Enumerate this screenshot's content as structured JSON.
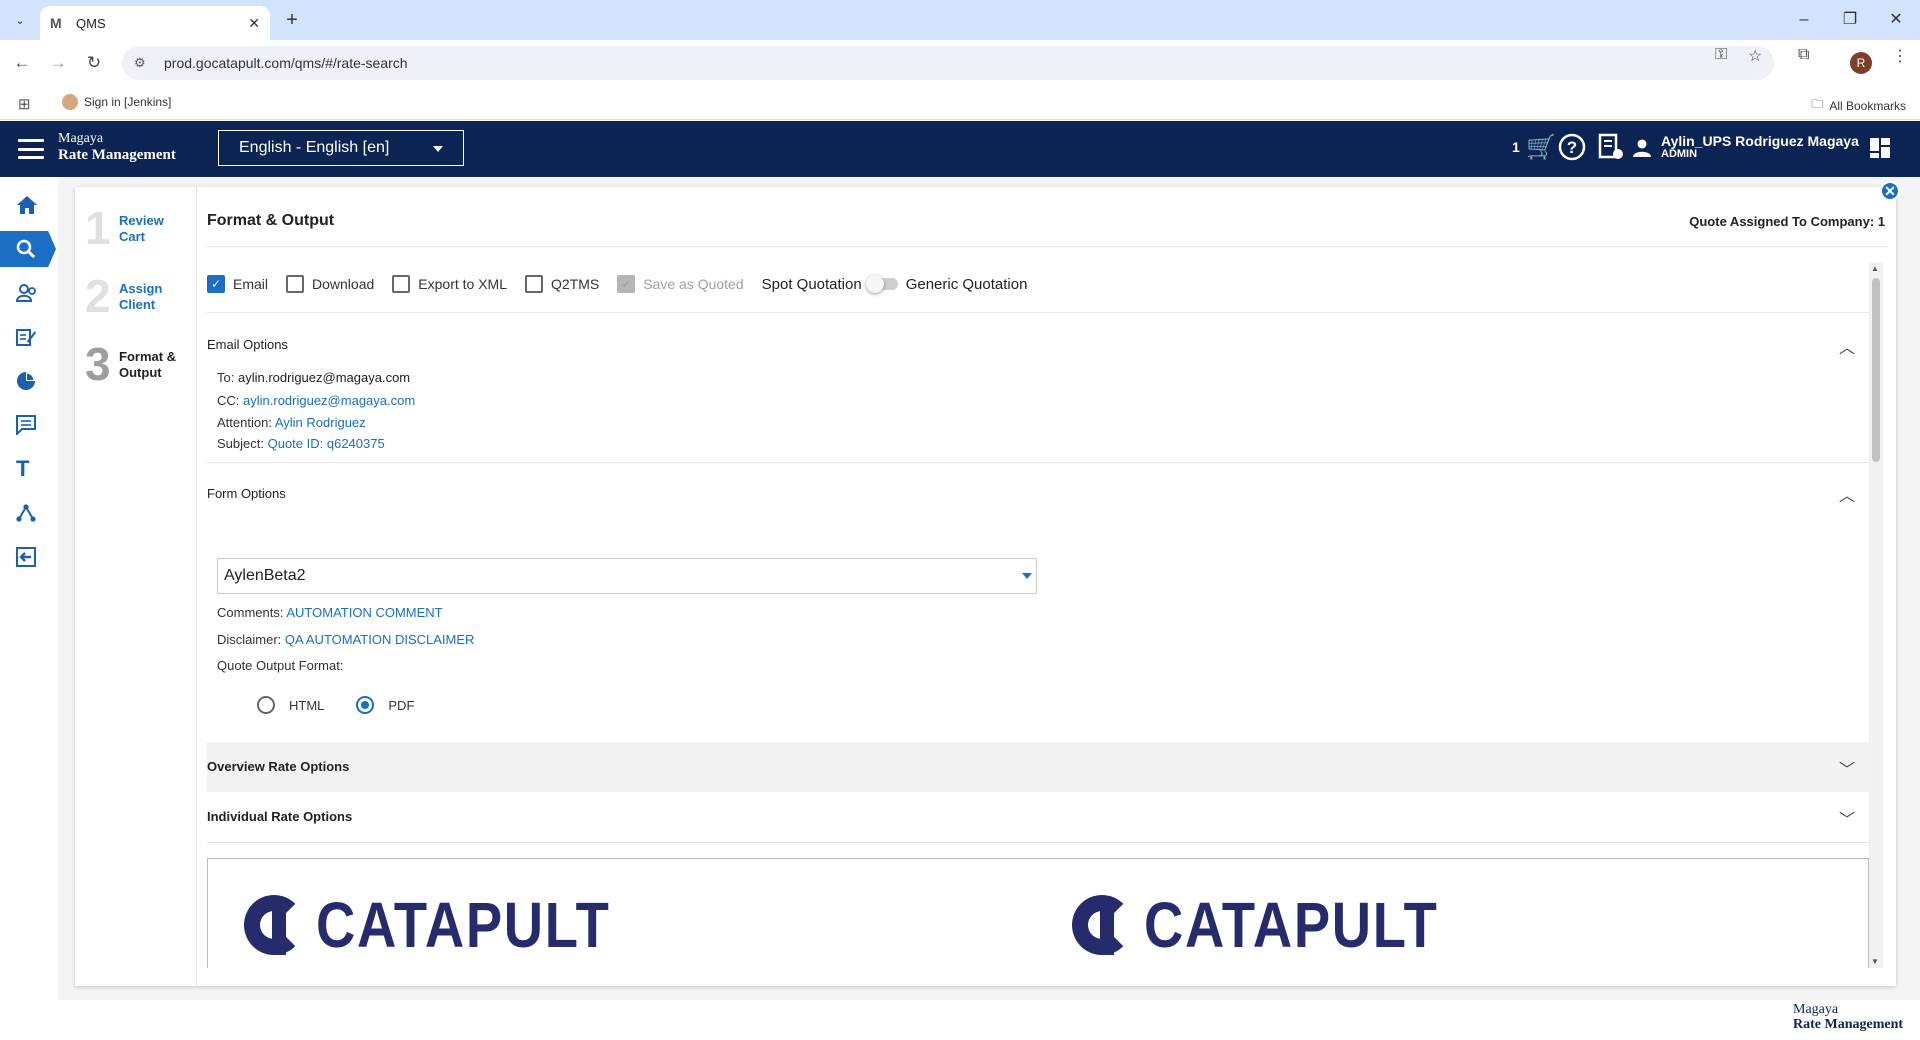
{
  "browser": {
    "tab_title": "QMS",
    "url": "prod.gocatapult.com/qms/#/rate-search",
    "bookmark_jenkins": "Sign in [Jenkins]",
    "all_bookmarks": "All Bookmarks",
    "profile_initial": "R"
  },
  "header": {
    "brand_top": "Magaya",
    "brand_bottom": "Rate Management",
    "language": "English - English [en]",
    "cart_count": "1",
    "user_name": "Aylin_UPS Rodriguez Magaya",
    "user_role": "ADMIN"
  },
  "steps": [
    {
      "num": "1",
      "label_1": "Review",
      "label_2": "Cart"
    },
    {
      "num": "2",
      "label_1": "Assign",
      "label_2": "Client"
    },
    {
      "num": "3",
      "label_1": "Format &",
      "label_2": "Output"
    }
  ],
  "page": {
    "title": "Format & Output",
    "company_assigned": "Quote Assigned To Company: 1"
  },
  "output_options": {
    "email": "Email",
    "download": "Download",
    "export_xml": "Export to XML",
    "q2tms": "Q2TMS",
    "save_quoted": "Save as Quoted",
    "spot_quotation": "Spot Quotation",
    "generic_quotation": "Generic Quotation"
  },
  "email_options": {
    "title": "Email Options",
    "to_label": "To:",
    "to_value": "aylin.rodriguez@magaya.com",
    "cc_label": "CC:",
    "cc_value": "aylin.rodriguez@magaya.com",
    "attention_label": "Attention:",
    "attention_value": "Aylin Rodriguez",
    "subject_label": "Subject:",
    "subject_value": "Quote ID: q6240375"
  },
  "form_options": {
    "title": "Form Options",
    "form_selected": "AylenBeta2",
    "comments_label": "Comments:",
    "comments_value": "AUTOMATION COMMENT",
    "disclaimer_label": "Disclaimer:",
    "disclaimer_value": "QA AUTOMATION DISCLAIMER",
    "output_format_label": "Quote Output Format:",
    "format_html": "HTML",
    "format_pdf": "PDF"
  },
  "overview_rate_options": "Overview Rate Options",
  "individual_rate_options": "Individual Rate Options",
  "preview": {
    "logo_text": "CATAPULT"
  },
  "footer": {
    "brand_top": "Magaya",
    "brand_bottom": "Rate Management"
  }
}
